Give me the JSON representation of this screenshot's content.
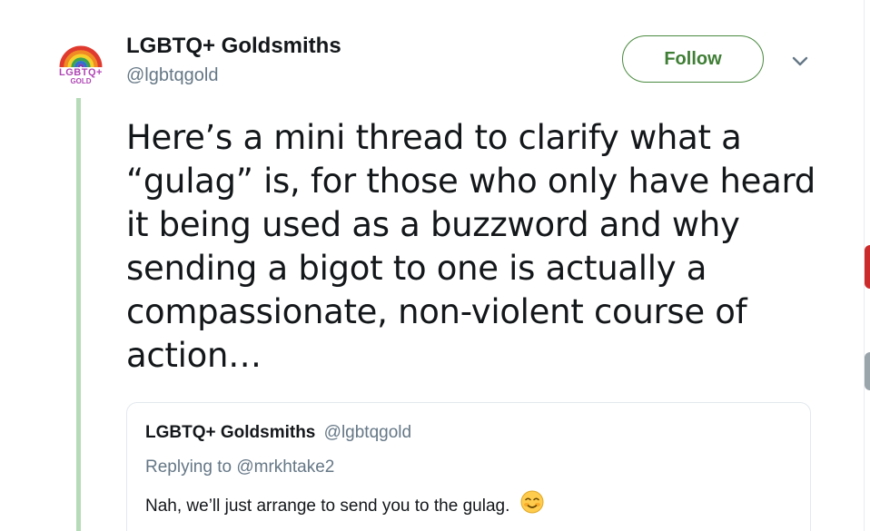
{
  "account": {
    "display_name": "LGBTQ+ Goldsmiths",
    "handle": "@lgbtqgold",
    "avatar_text_line1": "LGBTQ+",
    "avatar_text_line2": "GOLD"
  },
  "actions": {
    "follow_label": "Follow",
    "more_icon": "chevron-down-icon"
  },
  "tweet": {
    "text": "Here’s a mini thread to clarify what a “gulag” is, for those who only have heard it being used as a buzzword and why sending a bigot to one is actually a compassionate, non-violent course of action…"
  },
  "quoted_tweet": {
    "display_name": "LGBTQ+ Goldsmiths",
    "handle": "@lgbtqgold",
    "replying_to": "Replying to @mrkhtake2",
    "text": "Nah, we’ll just arrange to send you to the gulag.",
    "emoji_icon": "smiling-blushing-face-icon"
  },
  "colors": {
    "follow_green": "#3f7e35",
    "thread_line": "#b6dbb9",
    "avatar_purple": "#b046b6",
    "secondary_text": "#657786"
  }
}
